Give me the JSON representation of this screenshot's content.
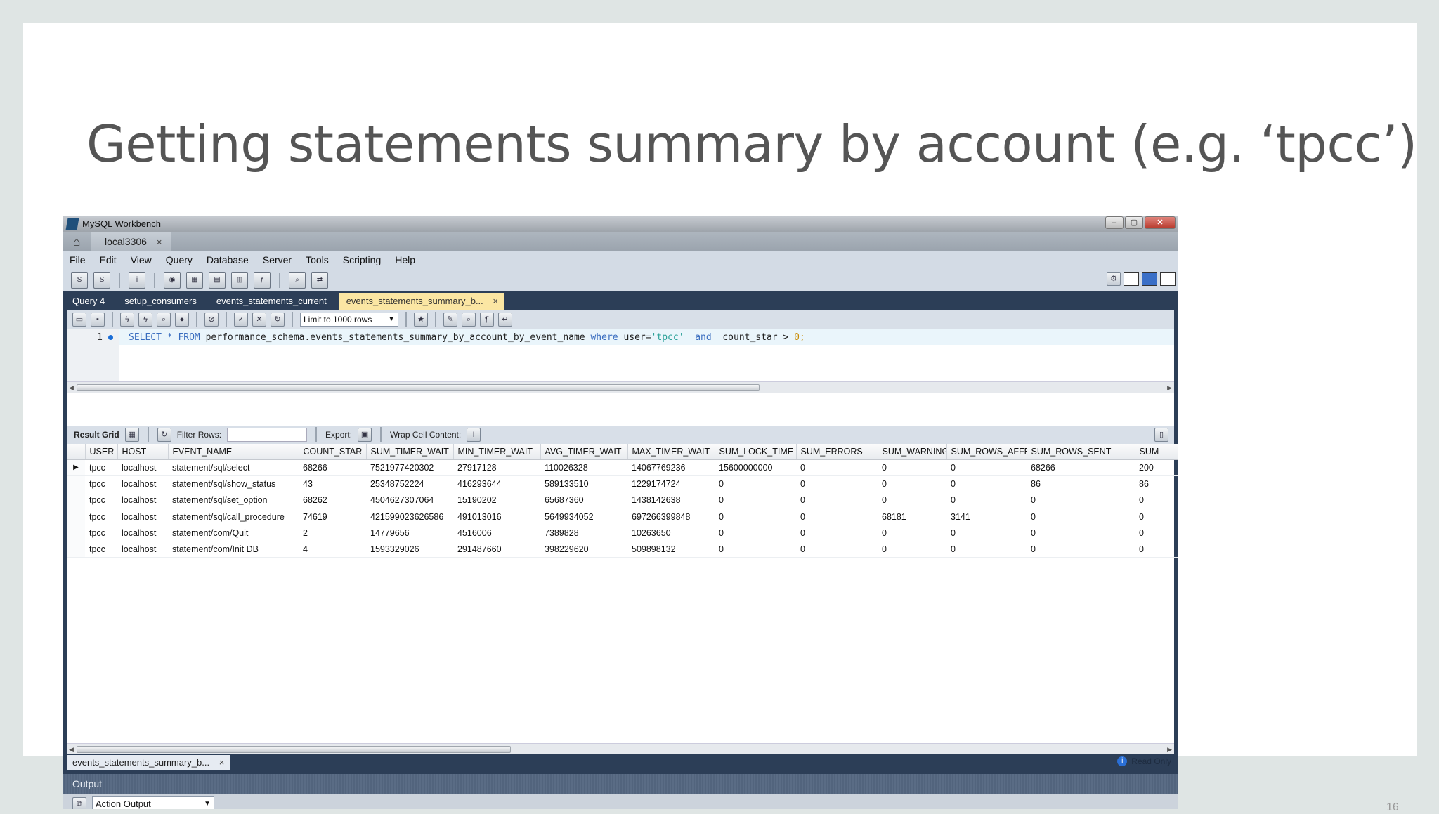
{
  "slide": {
    "title": "Getting statements summary by account (e.g. ‘tpcc’)",
    "page_number": "16"
  },
  "window": {
    "title": "MySQL Workbench",
    "buttons": [
      "–",
      "▢",
      "✕"
    ]
  },
  "connection_tab": {
    "label": "local3306",
    "close": "×"
  },
  "menu": [
    "File",
    "Edit",
    "View",
    "Query",
    "Database",
    "Server",
    "Tools",
    "Scripting",
    "Help"
  ],
  "query_tabs": [
    "Query 4",
    "setup_consumers",
    "events_statements_current",
    "events_statements_summary_b..."
  ],
  "editor": {
    "limit_label": "Limit to 1000 rows",
    "line_number": "1",
    "sql": {
      "select": "SELECT",
      "star": "*",
      "from": "FROM",
      "table": "performance_schema.events_statements_summary_by_account_by_event_name",
      "where": "where",
      "cond1": "user=",
      "user_value": "'tpcc'",
      "and": "and",
      "cond2": "count_star >",
      "zero": "0;"
    }
  },
  "result_toolbar": {
    "result_grid": "Result Grid",
    "filter_rows": "Filter Rows:",
    "export": "Export:",
    "wrap": "Wrap Cell Content:"
  },
  "grid": {
    "columns": [
      "USER",
      "HOST",
      "EVENT_NAME",
      "COUNT_STAR",
      "SUM_TIMER_WAIT",
      "MIN_TIMER_WAIT",
      "AVG_TIMER_WAIT",
      "MAX_TIMER_WAIT",
      "SUM_LOCK_TIME",
      "SUM_ERRORS",
      "SUM_WARNINGS",
      "SUM_ROWS_AFFECTED",
      "SUM_ROWS_SENT",
      "SUM"
    ],
    "rows": [
      [
        "tpcc",
        "localhost",
        "statement/sql/select",
        "68266",
        "7521977420302",
        "27917128",
        "110026328",
        "14067769236",
        "15600000000",
        "0",
        "0",
        "0",
        "68266",
        "200"
      ],
      [
        "tpcc",
        "localhost",
        "statement/sql/show_status",
        "43",
        "25348752224",
        "416293644",
        "589133510",
        "1229174724",
        "0",
        "0",
        "0",
        "0",
        "86",
        "86"
      ],
      [
        "tpcc",
        "localhost",
        "statement/sql/set_option",
        "68262",
        "4504627307064",
        "15190202",
        "65687360",
        "1438142638",
        "0",
        "0",
        "0",
        "0",
        "0",
        "0"
      ],
      [
        "tpcc",
        "localhost",
        "statement/sql/call_procedure",
        "74619",
        "421599023626586",
        "491013016",
        "5649934052",
        "697266399848",
        "0",
        "0",
        "68181",
        "3141",
        "0",
        "0"
      ],
      [
        "tpcc",
        "localhost",
        "statement/com/Quit",
        "2",
        "14779656",
        "4516006",
        "7389828",
        "10263650",
        "0",
        "0",
        "0",
        "0",
        "0",
        "0"
      ],
      [
        "tpcc",
        "localhost",
        "statement/com/Init DB",
        "4",
        "1593329026",
        "291487660",
        "398229620",
        "509898132",
        "0",
        "0",
        "0",
        "0",
        "0",
        "0"
      ]
    ],
    "current_row_marker": "▶"
  },
  "result_tab": {
    "label": "events_statements_summary_b...",
    "close": "×",
    "read_only": "Read Only"
  },
  "output": {
    "title": "Output",
    "selected": "Action Output"
  }
}
